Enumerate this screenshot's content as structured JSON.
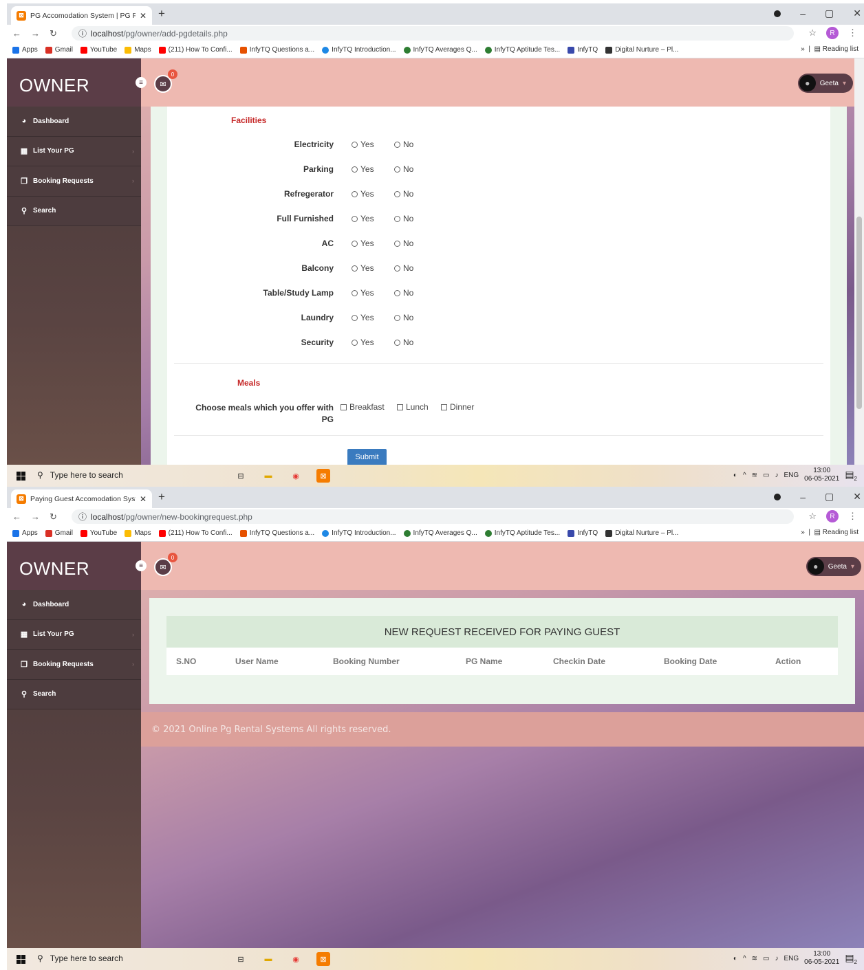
{
  "browser": {
    "bookmarks": [
      {
        "label": "Apps",
        "color": "#1a73e8"
      },
      {
        "label": "Gmail",
        "color": "#d93025"
      },
      {
        "label": "YouTube",
        "color": "#ff0000"
      },
      {
        "label": "Maps",
        "color": "#fbbc05"
      },
      {
        "label": "(211) How To Confi...",
        "color": "#ff0000"
      },
      {
        "label": "InfyTQ Questions a...",
        "color": "#e65100"
      },
      {
        "label": "InfyTQ Introduction...",
        "color": "#1e88e5"
      },
      {
        "label": "InfyTQ Averages Q...",
        "color": "#2e7d32"
      },
      {
        "label": "InfyTQ Aptitude Tes...",
        "color": "#2e7d32"
      },
      {
        "label": "InfyTQ",
        "color": "#3949ab"
      },
      {
        "label": "Digital Nurture – Pl...",
        "color": "#333333"
      }
    ],
    "bookmark_overflow": "»",
    "reading_list": "Reading list",
    "profile_initial": "R"
  },
  "taskbar": {
    "search_placeholder": "Type here to search",
    "lang": "ENG",
    "time": "13:00",
    "date": "06-05-2021",
    "notif_count": "2"
  },
  "app": {
    "brand": "OWNER",
    "user_name": "Geeta",
    "mail_badge": "0",
    "sidebar": [
      {
        "label": "Dashboard",
        "icon": "dashboard-icon"
      },
      {
        "label": "List Your PG",
        "icon": "grid-icon"
      },
      {
        "label": "Booking Requests",
        "icon": "copy-icon"
      },
      {
        "label": "Search",
        "icon": "search-icon"
      }
    ]
  },
  "window1": {
    "tab_title": "PG Accomodation System | PG Fo",
    "url_host": "localhost",
    "url_path": "/pg/owner/add-pgdetails.php",
    "facilities_title": "Facilities",
    "facilities": [
      "Electricity",
      "Parking",
      "Refregerator",
      "Full Furnished",
      "AC",
      "Balcony",
      "Table/Study Lamp",
      "Laundry",
      "Security"
    ],
    "yes_label": "Yes",
    "no_label": "No",
    "meals_title": "Meals",
    "meals_label_line1": "Choose meals which you offer with",
    "meals_label_line2": "PG",
    "meal_options": [
      "Breakfast",
      "Lunch",
      "Dinner"
    ],
    "submit_label": "Submit"
  },
  "window2": {
    "tab_title": "Paying Guest Accomodation Syst",
    "url_host": "localhost",
    "url_path": "/pg/owner/new-bookingrequest.php",
    "table_title": "NEW REQUEST RECEIVED FOR PAYING GUEST",
    "columns": [
      "S.NO",
      "User Name",
      "Booking Number",
      "PG Name",
      "Checkin Date",
      "Booking Date",
      "Action"
    ],
    "footer": "© 2021 Online Pg Rental Systems All rights reserved."
  }
}
